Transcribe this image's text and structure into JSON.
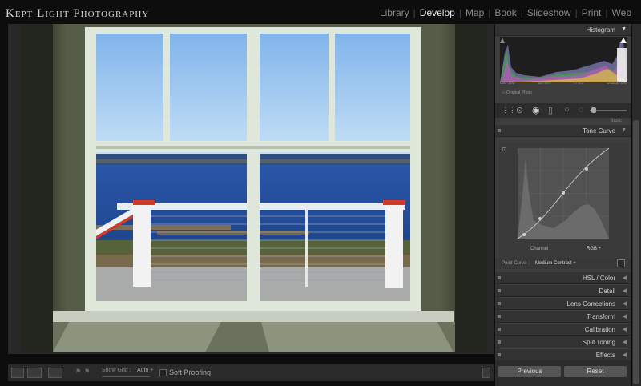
{
  "brand": "Kept Light Photography",
  "modules": [
    {
      "label": "Library",
      "active": false
    },
    {
      "label": "Develop",
      "active": true
    },
    {
      "label": "Map",
      "active": false
    },
    {
      "label": "Book",
      "active": false
    },
    {
      "label": "Slideshow",
      "active": false
    },
    {
      "label": "Print",
      "active": false
    },
    {
      "label": "Web",
      "active": false
    }
  ],
  "histogram": {
    "title": "Histogram",
    "iso": "ISO 100",
    "focal": "18 mm",
    "aperture": "f / 6.3",
    "shutter": "1/1250 sec",
    "original_photo": "Original Photo"
  },
  "basic_label": "Basic",
  "tone_curve": {
    "title": "Tone Curve",
    "channel_label": "Channel :",
    "channel_value": "RGB ÷",
    "point_curve_label": "Point Curve :",
    "point_curve_value": "Medium Contrast ÷"
  },
  "panels": [
    "HSL / Color",
    "Detail",
    "Lens Corrections",
    "Transform",
    "Calibration",
    "Split Toning",
    "Effects"
  ],
  "toolbar": {
    "show_grid_label": "Show Grid :",
    "show_grid_value": "Auto ÷",
    "soft_proofing": "Soft Proofing"
  },
  "buttons": {
    "previous": "Previous",
    "reset": "Reset"
  },
  "colors": {
    "accent": "#e0e0e0",
    "panel": "#3d3d3d",
    "background": "#0d0d0d"
  }
}
